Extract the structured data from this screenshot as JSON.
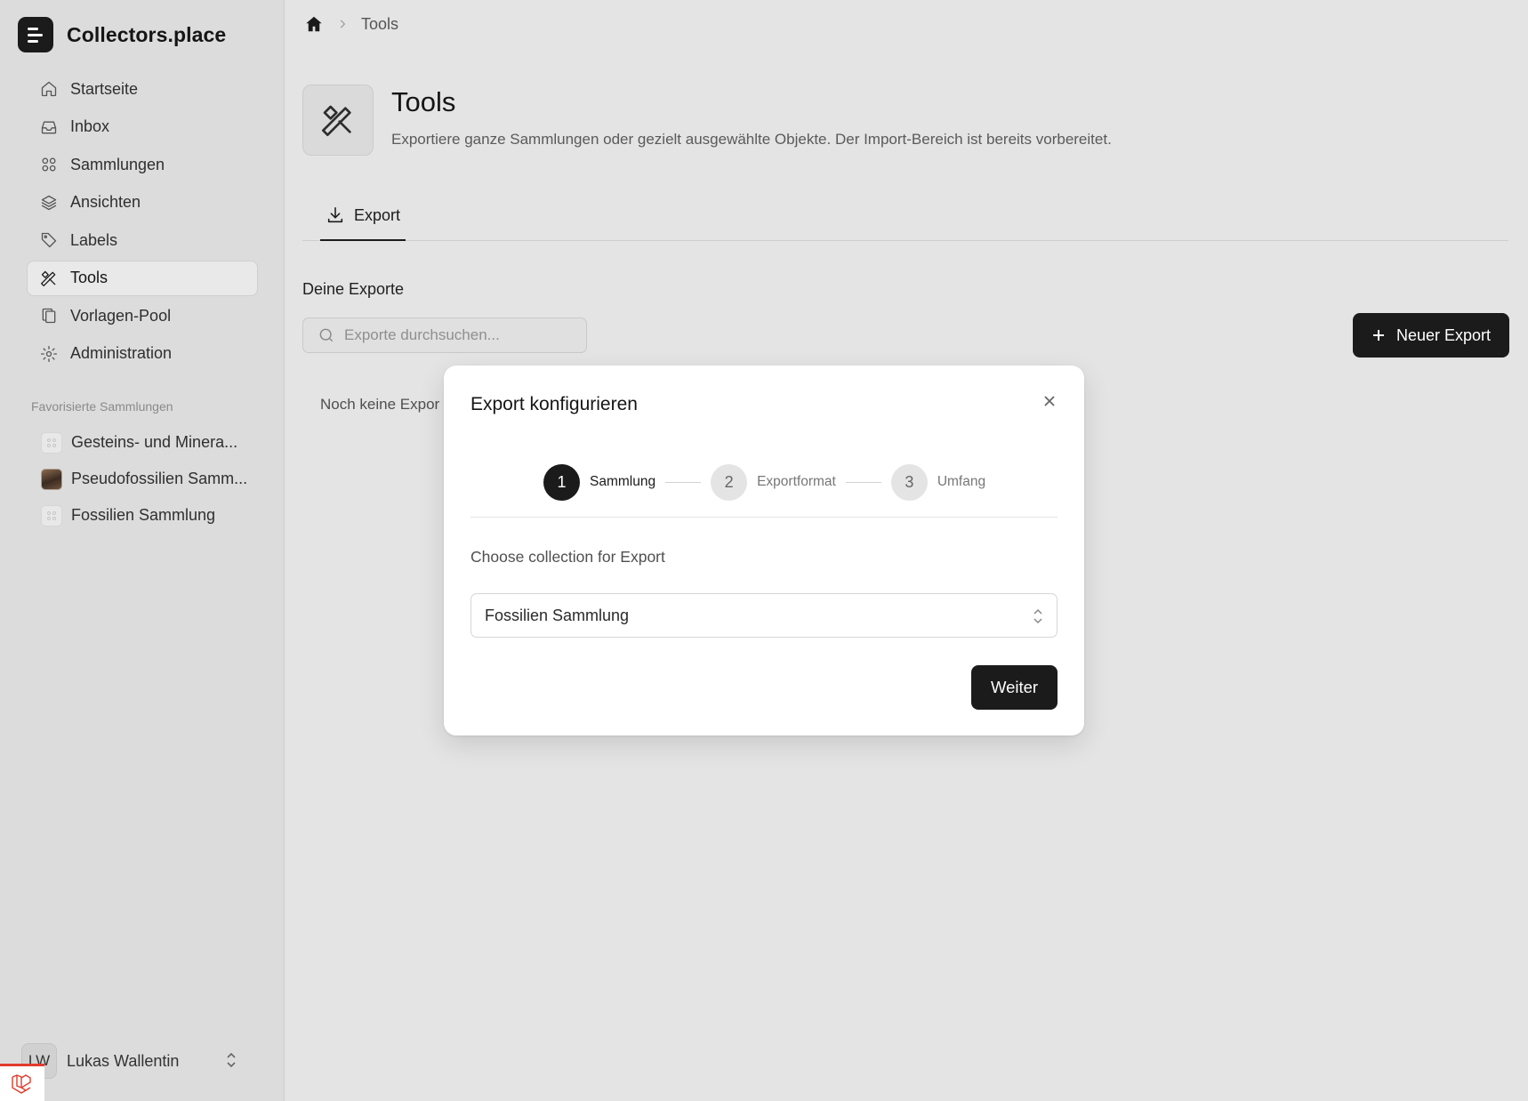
{
  "app": {
    "name": "Collectors.place"
  },
  "sidebar": {
    "nav": [
      {
        "label": "Startseite",
        "icon": "home-icon"
      },
      {
        "label": "Inbox",
        "icon": "inbox-icon"
      },
      {
        "label": "Sammlungen",
        "icon": "grid-icon"
      },
      {
        "label": "Ansichten",
        "icon": "layers-icon"
      },
      {
        "label": "Labels",
        "icon": "tag-icon"
      },
      {
        "label": "Tools",
        "icon": "tools-icon",
        "active": true
      },
      {
        "label": "Vorlagen-Pool",
        "icon": "copy-icon"
      },
      {
        "label": "Administration",
        "icon": "gear-icon"
      }
    ],
    "favorites_title": "Favorisierte Sammlungen",
    "favorites": [
      {
        "label": "Gesteins- und Minera..."
      },
      {
        "label": "Pseudofossilien Samm..."
      },
      {
        "label": "Fossilien Sammlung"
      }
    ],
    "user": {
      "initials": "LW",
      "name": "Lukas Wallentin"
    }
  },
  "breadcrumb": {
    "current": "Tools"
  },
  "page": {
    "title": "Tools",
    "subtitle": "Exportiere ganze Sammlungen oder gezielt ausgewählte Objekte. Der Import-Bereich ist bereits vorbereitet.",
    "tab_export": "Export",
    "section_title": "Deine Exporte",
    "search_placeholder": "Exporte durchsuchen...",
    "new_export": "Neuer Export",
    "empty_text": "Noch keine Expor"
  },
  "modal": {
    "title": "Export konfigurieren",
    "steps": [
      {
        "num": "1",
        "label": "Sammlung",
        "active": true
      },
      {
        "num": "2",
        "label": "Exportformat",
        "active": false
      },
      {
        "num": "3",
        "label": "Umfang",
        "active": false
      }
    ],
    "label": "Choose collection for Export",
    "selected_collection": "Fossilien Sammlung",
    "next_button": "Weiter"
  },
  "colors": {
    "primary": "#1b1b1b",
    "background": "#e4e4e4",
    "sidebar": "#dcdcdc",
    "laravel_red": "#e23b2e"
  }
}
